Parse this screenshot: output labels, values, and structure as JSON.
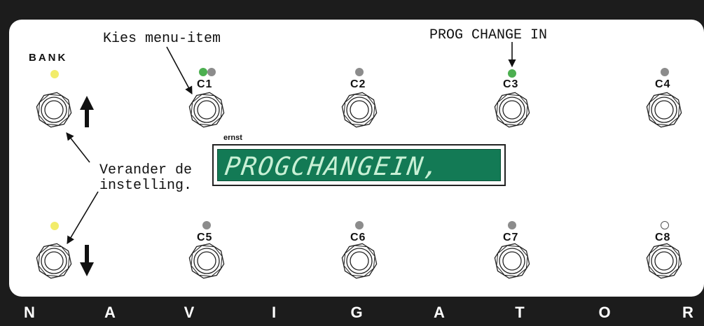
{
  "bank_label": "BANK",
  "annotations": {
    "select_item": "Kies menu-item",
    "prog_change_in": "PROG CHANGE IN",
    "change_setting": "Verander de\ninstelling."
  },
  "display": {
    "owner": "ernst",
    "text": "PROGCHANGEIN,",
    "color": "#137a55"
  },
  "channels": {
    "c1": "C1",
    "c2": "C2",
    "c3": "C3",
    "c4": "C4",
    "c5": "C5",
    "c6": "C6",
    "c7": "C7",
    "c8": "C8"
  },
  "leds": {
    "bank_up": "yellow",
    "bank_down": "yellow",
    "c1": "green+gray",
    "c2": "gray",
    "c3": "green",
    "c4": "gray",
    "c5": "gray",
    "c6": "gray",
    "c7": "gray",
    "c8": "off"
  },
  "colors": {
    "led_green": "#4caf50",
    "led_gray": "#8c8c8c",
    "led_yellow": "#f2ec6a",
    "frame": "#1c1c1c"
  },
  "footer": [
    "N",
    "A",
    "V",
    "I",
    "G",
    "A",
    "T",
    "O",
    "R"
  ]
}
